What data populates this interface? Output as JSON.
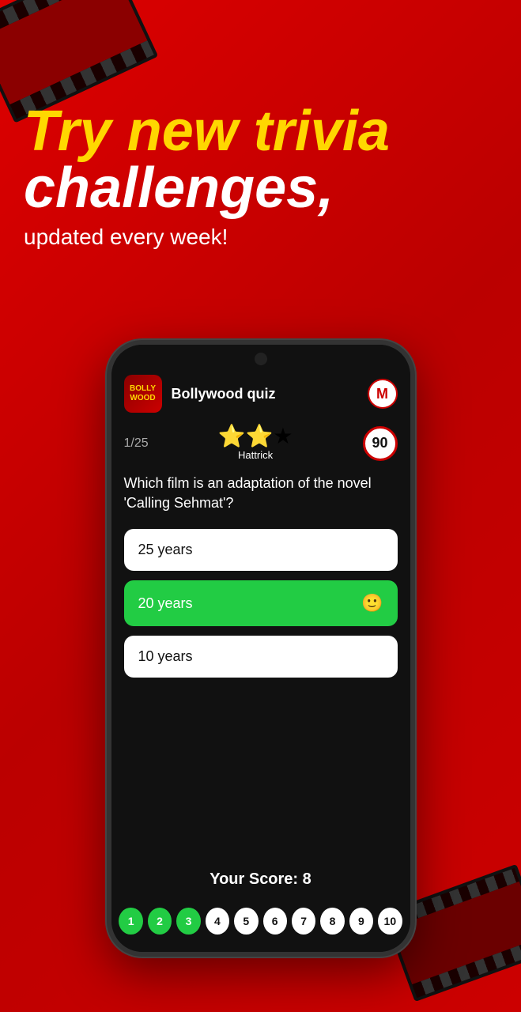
{
  "background": {
    "color": "#cc0000"
  },
  "hero": {
    "line1": "Try new trivia",
    "line2": "challenges,",
    "subtitle": "updated every week!"
  },
  "phone": {
    "header": {
      "quiz_name": "Bollywood quiz",
      "avatar_label": "M"
    },
    "progress": {
      "question_num": "1/25",
      "stars": "⭐⭐★",
      "hattrick": "Hattrick",
      "timer": "90"
    },
    "question": "Which film is an adaptation of the novel 'Calling Sehmat'?",
    "answers": [
      {
        "text": "25 years",
        "state": "default"
      },
      {
        "text": "20 years",
        "state": "correct"
      },
      {
        "text": "10 years",
        "state": "default"
      }
    ],
    "score_label": "Your Score: 8",
    "progress_dots": [
      {
        "num": "1",
        "state": "green"
      },
      {
        "num": "2",
        "state": "green"
      },
      {
        "num": "3",
        "state": "green"
      },
      {
        "num": "4",
        "state": "white"
      },
      {
        "num": "5",
        "state": "white"
      },
      {
        "num": "6",
        "state": "white"
      },
      {
        "num": "7",
        "state": "white"
      },
      {
        "num": "8",
        "state": "white"
      },
      {
        "num": "9",
        "state": "white"
      },
      {
        "num": "10",
        "state": "white"
      }
    ]
  }
}
